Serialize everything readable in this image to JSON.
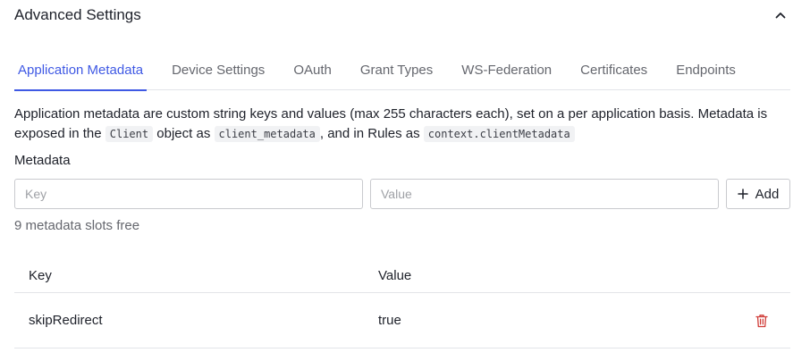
{
  "section": {
    "title": "Advanced Settings",
    "collapse_icon": "chevron-up-icon"
  },
  "tabs": [
    {
      "label": "Application Metadata",
      "active": true
    },
    {
      "label": "Device Settings",
      "active": false
    },
    {
      "label": "OAuth",
      "active": false
    },
    {
      "label": "Grant Types",
      "active": false
    },
    {
      "label": "WS-Federation",
      "active": false
    },
    {
      "label": "Certificates",
      "active": false
    },
    {
      "label": "Endpoints",
      "active": false
    }
  ],
  "description": {
    "part1": "Application metadata are custom string keys and values (max 255 characters each), set on a per application basis. Metadata is exposed in the",
    "code1": "Client",
    "part2": "object as",
    "code2": "client_metadata",
    "part3": ", and in Rules as",
    "code3": "context.clientMetadata"
  },
  "metadata_form": {
    "label": "Metadata",
    "key_placeholder": "Key",
    "key_value": "",
    "value_placeholder": "Value",
    "value_value": "",
    "add_label": "Add",
    "add_icon": "plus-icon",
    "slots_text": "9 metadata slots free"
  },
  "table": {
    "headers": {
      "key": "Key",
      "value": "Value"
    },
    "rows": [
      {
        "key": "skipRedirect",
        "value": "true",
        "action_icon": "trash-icon"
      }
    ]
  },
  "colors": {
    "accent": "#3f59e4",
    "danger": "#d03c38",
    "text": "#1e212a",
    "muted": "#65676e",
    "border": "#e3e4e8"
  }
}
